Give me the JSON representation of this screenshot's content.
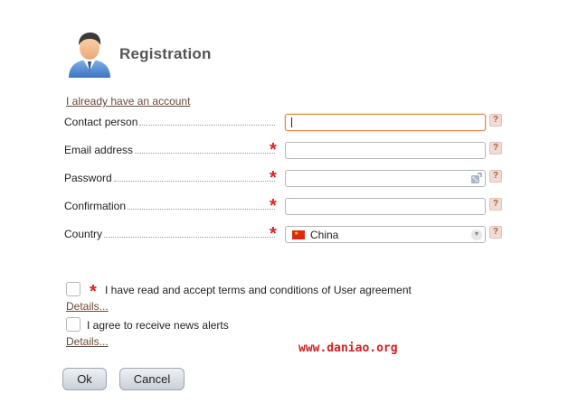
{
  "header": {
    "title": "Registration",
    "avatar_icon": "user-avatar-icon"
  },
  "account_link": "I already have an account",
  "fields": [
    {
      "label": "Contact person",
      "required": false,
      "value": ""
    },
    {
      "label": "Email address",
      "required": true,
      "value": ""
    },
    {
      "label": "Password",
      "required": true,
      "value": ""
    },
    {
      "label": "Confirmation",
      "required": true,
      "value": ""
    },
    {
      "label": "Country",
      "required": true,
      "value": "China"
    }
  ],
  "required_mark": "*",
  "help_mark": "?",
  "agreement": {
    "text": "I have read and accept terms and conditions of User agreement",
    "required": true,
    "details": "Details..."
  },
  "news": {
    "text": "I agree to receive news alerts",
    "details": "Details..."
  },
  "watermark": "www.daniao.org",
  "buttons": {
    "ok": "Ok",
    "cancel": "Cancel"
  },
  "colors": {
    "required": "#e02020",
    "link": "#6a4a36",
    "focus_border": "#d48a4c"
  }
}
